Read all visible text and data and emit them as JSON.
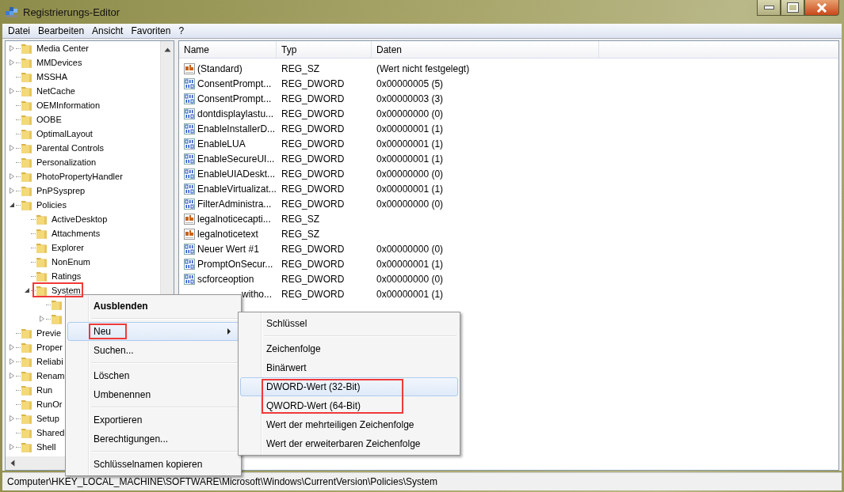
{
  "window": {
    "title": "Registrierungs-Editor"
  },
  "menu_bar": [
    "Datei",
    "Bearbeiten",
    "Ansicht",
    "Favoriten",
    "?"
  ],
  "tree": [
    {
      "name": "Media Center",
      "has_children": true,
      "expanded": false
    },
    {
      "name": "MMDevices",
      "has_children": true,
      "expanded": false
    },
    {
      "name": "MSSHA",
      "has_children": false
    },
    {
      "name": "NetCache",
      "has_children": true,
      "expanded": false
    },
    {
      "name": "OEMInformation",
      "has_children": false
    },
    {
      "name": "OOBE",
      "has_children": false
    },
    {
      "name": "OptimalLayout",
      "has_children": false
    },
    {
      "name": "Parental Controls",
      "has_children": true,
      "expanded": false
    },
    {
      "name": "Personalization",
      "has_children": false
    },
    {
      "name": "PhotoPropertyHandler",
      "has_children": true,
      "expanded": false
    },
    {
      "name": "PnPSysprep",
      "has_children": true,
      "expanded": false
    },
    {
      "name": "Policies",
      "has_children": true,
      "expanded": true,
      "children": [
        {
          "name": "ActiveDesktop",
          "has_children": false
        },
        {
          "name": "Attachments",
          "has_children": false
        },
        {
          "name": "Explorer",
          "has_children": false
        },
        {
          "name": "NonEnum",
          "has_children": false
        },
        {
          "name": "Ratings",
          "has_children": false
        },
        {
          "name": "System",
          "has_children": true,
          "expanded": true,
          "annotated": true,
          "children": [
            {
              "has_children": false
            },
            {
              "has_children": true,
              "expanded": false
            }
          ]
        }
      ]
    },
    {
      "name": "Previe",
      "has_children": false
    },
    {
      "name": "Proper",
      "has_children": true,
      "expanded": false
    },
    {
      "name": "Reliabi",
      "has_children": true,
      "expanded": false
    },
    {
      "name": "Renam",
      "has_children": true,
      "expanded": false
    },
    {
      "name": "Run",
      "has_children": false
    },
    {
      "name": "RunOr",
      "has_children": false
    },
    {
      "name": "Setup",
      "has_children": true,
      "expanded": false
    },
    {
      "name": "Shared",
      "has_children": false
    },
    {
      "name": "Shell",
      "has_children": true,
      "expanded": false
    }
  ],
  "table": {
    "columns": [
      "Name",
      "Typ",
      "Daten"
    ],
    "rows": [
      {
        "kind": "string",
        "name": "(Standard)",
        "type": "REG_SZ",
        "data": "(Wert nicht festgelegt)"
      },
      {
        "kind": "binary",
        "name": "ConsentPrompt...",
        "type": "REG_DWORD",
        "data": "0x00000005 (5)"
      },
      {
        "kind": "binary",
        "name": "ConsentPrompt...",
        "type": "REG_DWORD",
        "data": "0x00000003 (3)"
      },
      {
        "kind": "binary",
        "name": "dontdisplaylastu...",
        "type": "REG_DWORD",
        "data": "0x00000000 (0)"
      },
      {
        "kind": "binary",
        "name": "EnableInstallerD...",
        "type": "REG_DWORD",
        "data": "0x00000001 (1)"
      },
      {
        "kind": "binary",
        "name": "EnableLUA",
        "type": "REG_DWORD",
        "data": "0x00000001 (1)"
      },
      {
        "kind": "binary",
        "name": "EnableSecureUI...",
        "type": "REG_DWORD",
        "data": "0x00000001 (1)"
      },
      {
        "kind": "binary",
        "name": "EnableUIADeskt...",
        "type": "REG_DWORD",
        "data": "0x00000000 (0)"
      },
      {
        "kind": "binary",
        "name": "EnableVirtualizat...",
        "type": "REG_DWORD",
        "data": "0x00000001 (1)"
      },
      {
        "kind": "binary",
        "name": "FilterAdministra...",
        "type": "REG_DWORD",
        "data": "0x00000000 (0)"
      },
      {
        "kind": "string",
        "name": "legalnoticecapti...",
        "type": "REG_SZ"
      },
      {
        "kind": "string",
        "name": "legalnoticetext",
        "type": "REG_SZ"
      },
      {
        "kind": "binary",
        "name": "Neuer Wert #1",
        "type": "REG_DWORD",
        "data": "0x00000000 (0)"
      },
      {
        "kind": "binary",
        "name": "PromptOnSecur...",
        "type": "REG_DWORD",
        "data": "0x00000001 (1)"
      },
      {
        "kind": "binary",
        "name": "scforceoption",
        "type": "REG_DWORD",
        "data": "0x00000000 (0)"
      },
      {
        "name": "witho...",
        "type": "REG_DWORD",
        "data": "0x00000001 (1)",
        "partly_hidden": true
      }
    ]
  },
  "context_menu": [
    {
      "kind": "item",
      "label": "Ausblenden",
      "bold": true,
      "highlighted": false
    },
    {
      "kind": "separator"
    },
    {
      "kind": "item",
      "label": "Neu",
      "highlighted": true,
      "submenu": true,
      "annotated": true
    },
    {
      "kind": "item",
      "label": "Suchen...",
      "highlighted": false
    },
    {
      "kind": "separator"
    },
    {
      "kind": "item",
      "label": "Löschen",
      "highlighted": false
    },
    {
      "kind": "item",
      "label": "Umbenennen",
      "highlighted": false
    },
    {
      "kind": "separator"
    },
    {
      "kind": "item",
      "label": "Exportieren",
      "highlighted": false
    },
    {
      "kind": "item",
      "label": "Berechtigungen...",
      "highlighted": false
    },
    {
      "kind": "separator"
    },
    {
      "kind": "item",
      "label": "Schlüsselnamen kopieren",
      "highlighted": false
    }
  ],
  "submenu": [
    {
      "kind": "item",
      "label": "Schlüssel",
      "highlighted": false
    },
    {
      "kind": "separator"
    },
    {
      "kind": "item",
      "label": "Zeichenfolge",
      "highlighted": false
    },
    {
      "kind": "item",
      "label": "Binärwert",
      "highlighted": false
    },
    {
      "kind": "item",
      "label": "DWORD-Wert (32-Bit)",
      "highlighted": true,
      "annotated": true
    },
    {
      "kind": "item",
      "label": "QWORD-Wert (64-Bit)",
      "highlighted": false,
      "annotated": true
    },
    {
      "kind": "item",
      "label": "Wert der mehrteiligen Zeichenfolge",
      "highlighted": false
    },
    {
      "kind": "item",
      "label": "Wert der erweiterbaren Zeichenfolge",
      "highlighted": false
    }
  ],
  "status_bar": "Computer\\HKEY_LOCAL_MACHINE\\SOFTWARE\\Microsoft\\Windows\\CurrentVersion\\Policies\\System"
}
